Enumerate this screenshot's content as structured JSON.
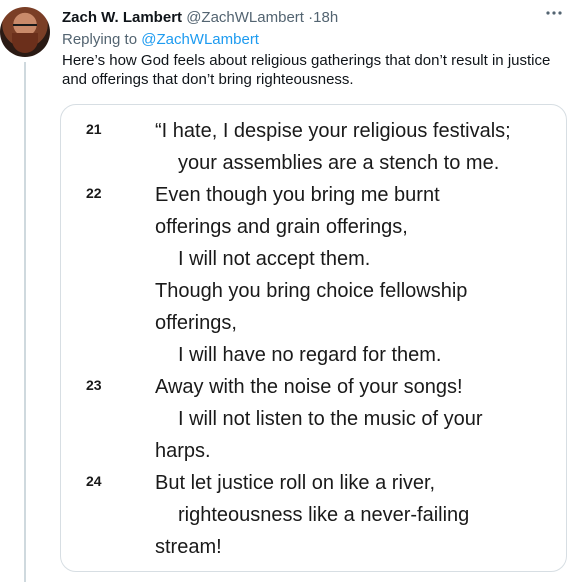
{
  "tweet": {
    "author_name": "Zach W. Lambert",
    "author_handle": "@ZachWLambert",
    "separator": "·",
    "timestamp": "18h",
    "more_icon": "ellipsis-icon",
    "replying_prefix": "Replying to",
    "replying_to": "@ZachWLambert",
    "text": "Here’s how God feels about religious gatherings that don’t result in justice and offerings that don’t bring righteousness."
  },
  "image": {
    "verses": [
      {
        "number": "21",
        "lines": [
          "“I hate, I despise your religious festivals;",
          "your assemblies are a stench to me."
        ]
      },
      {
        "number": "22",
        "lines": [
          "Even though you bring me burnt",
          "offerings and grain offerings,",
          "I will not accept them.",
          "Though you bring choice fellowship",
          "offerings,",
          "I will have no regard for them."
        ]
      },
      {
        "number": "23",
        "lines": [
          "Away with the noise of your songs!",
          "I will not listen to the music of your",
          "harps."
        ]
      },
      {
        "number": "24",
        "lines": [
          "But let justice roll on like a river,",
          "righteousness like a never-failing",
          "stream!"
        ]
      }
    ]
  }
}
